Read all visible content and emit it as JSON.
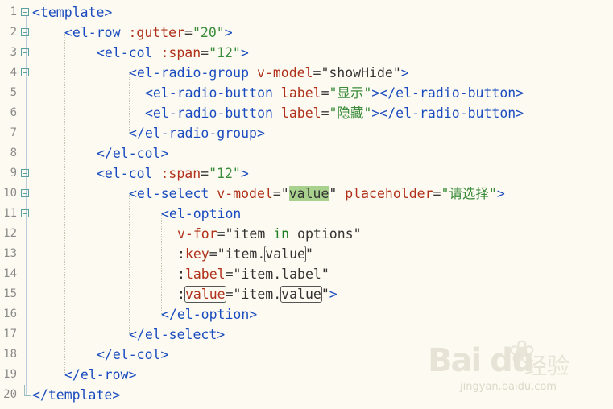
{
  "lines": [
    {
      "n": "1",
      "code": "<template>"
    },
    {
      "n": "2",
      "code": "<el-row :gutter=\"20\">"
    },
    {
      "n": "3",
      "code": "<el-col :span=\"12\">"
    },
    {
      "n": "4",
      "code": "<el-radio-group v-model=\"showHide\">"
    },
    {
      "n": "5",
      "code": "<el-radio-button label=\"显示\"></el-radio-button>"
    },
    {
      "n": "6",
      "code": "<el-radio-button label=\"隐藏\"></el-radio-button>"
    },
    {
      "n": "7",
      "code": "</el-radio-group>"
    },
    {
      "n": "8",
      "code": "</el-col>"
    },
    {
      "n": "9",
      "code": "<el-col :span=\"12\">"
    },
    {
      "n": "10",
      "code": "<el-select v-model=\"value\" placeholder=\"请选择\">"
    },
    {
      "n": "11",
      "code": "<el-option"
    },
    {
      "n": "12",
      "code": "v-for=\"item in options\""
    },
    {
      "n": "13",
      "code": ":key=\"item.value\""
    },
    {
      "n": "14",
      "code": ":label=\"item.label\""
    },
    {
      "n": "15",
      "code": ":value=\"item.value\">"
    },
    {
      "n": "16",
      "code": "</el-option>"
    },
    {
      "n": "17",
      "code": "</el-select>"
    },
    {
      "n": "18",
      "code": "</el-col>"
    },
    {
      "n": "19",
      "code": "</el-row>"
    },
    {
      "n": "20",
      "code": "</template>"
    }
  ],
  "watermark": {
    "logo": "Bai du",
    "name": "经验",
    "url": "jingyan.baidu.com"
  }
}
